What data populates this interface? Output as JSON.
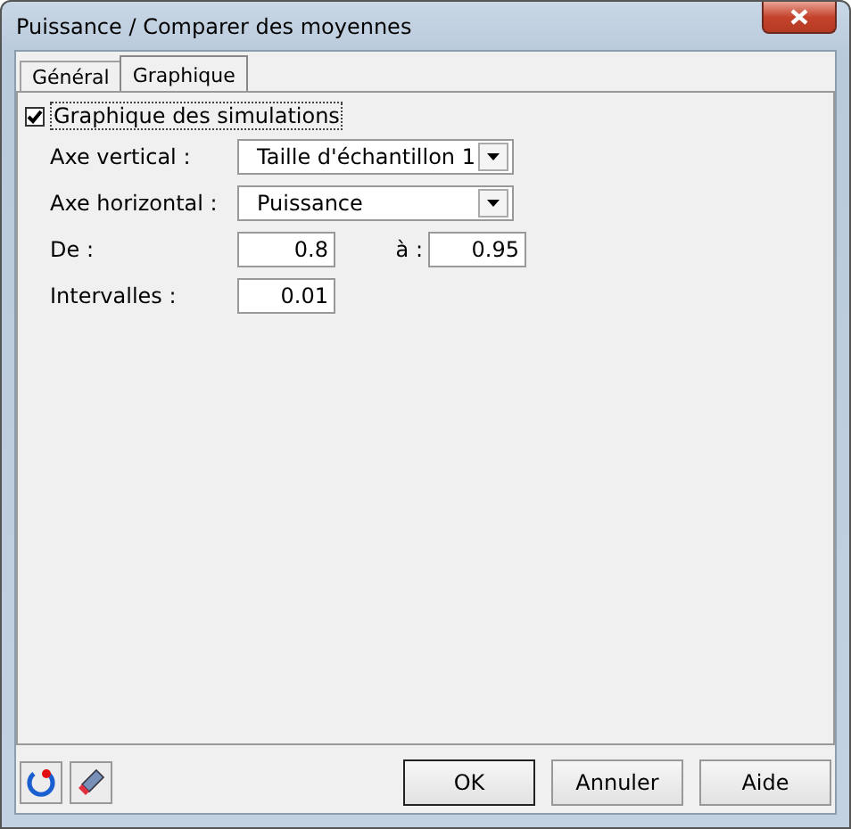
{
  "window": {
    "title": "Puissance / Comparer des moyennes"
  },
  "tabs": [
    {
      "label": "Général",
      "selected": false
    },
    {
      "label": "Graphique",
      "selected": true
    }
  ],
  "simulation_chart": {
    "label": "Graphique des simulations",
    "checked": true
  },
  "vertical_axis": {
    "label": "Axe vertical :",
    "value": "Taille d'échantillon 1"
  },
  "horizontal_axis": {
    "label": "Axe horizontal :",
    "value": "Puissance"
  },
  "range": {
    "from_label": "De :",
    "from_value": "0.8",
    "to_label": "à :",
    "to_value": "0.95"
  },
  "intervals": {
    "label": "Intervalles :",
    "value": "0.01"
  },
  "buttons": [
    "OK",
    "Annuler",
    "Aide"
  ]
}
